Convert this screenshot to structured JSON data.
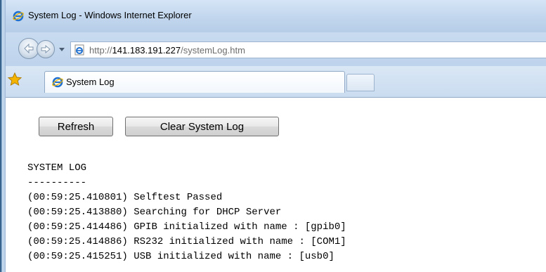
{
  "window": {
    "title": "System Log - Windows Internet Explorer"
  },
  "address_bar": {
    "url_prefix": "http://",
    "url_host": "141.183.191.227",
    "url_path": "/systemLog.htm"
  },
  "tabs": [
    {
      "label": "System Log",
      "active": true
    }
  ],
  "page": {
    "buttons": {
      "refresh_label": "Refresh",
      "clear_label": "Clear System Log"
    },
    "log_heading": "SYSTEM LOG",
    "log_separator": "----------",
    "log_entries": [
      {
        "time": "(00:59:25.410801)",
        "message": "Selftest Passed"
      },
      {
        "time": "(00:59:25.413880)",
        "message": "Searching for DHCP Server"
      },
      {
        "time": "(00:59:25.414486)",
        "message": "GPIB initialized with name : [gpib0]"
      },
      {
        "time": "(00:59:25.414886)",
        "message": "RS232 initialized with name : [COM1]"
      },
      {
        "time": "(00:59:25.415251)",
        "message": "USB initialized with name : [usb0]"
      }
    ]
  },
  "icons": {
    "title": "ie-logo-icon",
    "back": "back-arrow-icon",
    "forward": "forward-arrow-icon",
    "history": "dropdown-arrow-icon",
    "page": "ie-page-icon",
    "favorites": "favorites-star-icon",
    "tab": "ie-logo-icon"
  },
  "colors": {
    "frame": "#c3d7ee",
    "ie_blue": "#1e6fd0",
    "star": "#f5b400"
  }
}
